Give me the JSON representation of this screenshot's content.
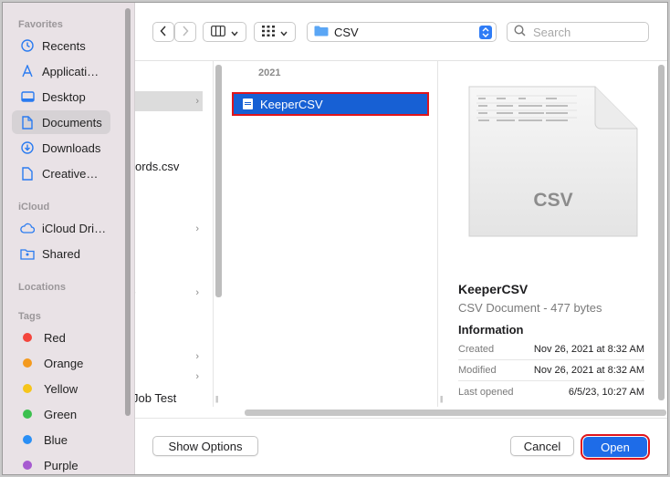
{
  "sidebar": {
    "favorites_header": "Favorites",
    "favorites": [
      {
        "label": "Recents",
        "icon": "clock-icon"
      },
      {
        "label": "Applicati…",
        "icon": "applications-icon"
      },
      {
        "label": "Desktop",
        "icon": "desktop-icon"
      },
      {
        "label": "Documents",
        "icon": "document-icon",
        "active": true
      },
      {
        "label": "Downloads",
        "icon": "download-icon"
      },
      {
        "label": "Creative…",
        "icon": "file-icon"
      }
    ],
    "icloud_header": "iCloud",
    "icloud": [
      {
        "label": "iCloud Dri…",
        "icon": "cloud-icon"
      },
      {
        "label": "Shared",
        "icon": "shared-folder-icon"
      }
    ],
    "locations_header": "Locations",
    "tags_header": "Tags",
    "tags": [
      {
        "label": "Red",
        "color": "#f4453d"
      },
      {
        "label": "Orange",
        "color": "#f49a1e"
      },
      {
        "label": "Yellow",
        "color": "#f6c51b"
      },
      {
        "label": "Green",
        "color": "#3cc04f"
      },
      {
        "label": "Blue",
        "color": "#2a8ff5"
      },
      {
        "label": "Purple",
        "color": "#a65ad0"
      }
    ]
  },
  "toolbar": {
    "path_label": "CSV",
    "search_placeholder": "Search"
  },
  "column1": {
    "rows": [
      "",
      "ords.csv",
      "",
      "",
      "",
      "",
      "",
      "Job Test"
    ]
  },
  "column2": {
    "header": "2021",
    "selected_file": "KeeperCSV"
  },
  "preview": {
    "icon_label": "CSV",
    "name": "KeeperCSV",
    "kind": "CSV Document - 477 bytes",
    "info_header": "Information",
    "meta": [
      {
        "key": "Created",
        "value": "Nov 26, 2021 at 8:32 AM"
      },
      {
        "key": "Modified",
        "value": "Nov 26, 2021 at 8:32 AM"
      },
      {
        "key": "Last opened",
        "value": "6/5/23, 10:27 AM"
      }
    ]
  },
  "footer": {
    "show_options": "Show Options",
    "cancel": "Cancel",
    "open": "Open"
  },
  "colors": {
    "accent": "#1e6ce8",
    "selection": "#1760d4",
    "highlight_outline": "#e0151b"
  }
}
